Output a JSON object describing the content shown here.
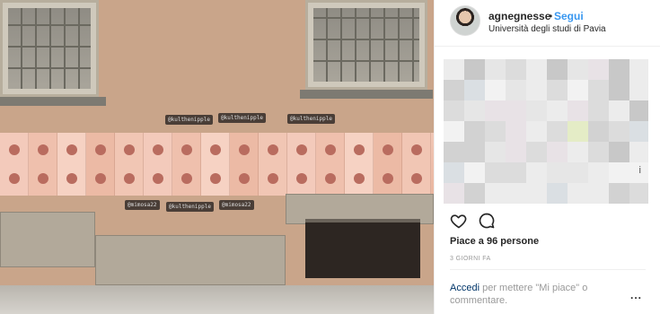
{
  "photo": {
    "stickers_tags": [
      "@kulthenipple",
      "@kulthenipple",
      "@kulthenipple",
      "@mimosa22",
      "@kulthenipple",
      "@mimosa22"
    ],
    "colors": {
      "wall": "#c9a58a",
      "sticker": "#efc1ae",
      "stone": "#b2a99a"
    }
  },
  "post": {
    "username": "agnegnesse",
    "separator": "•",
    "follow_label": "Segui",
    "location": "Università degli studi di Pavia",
    "caption_trailing_char": "i",
    "likes": "Piace a 96 persone",
    "time_ago": "3 GIORNI FA",
    "login_prompt": {
      "link": "Accedi",
      "rest": " per mettere \"Mi piace\" o commentare."
    },
    "more_label": "..."
  },
  "icons": {
    "like": "heart-outline-icon",
    "comment": "comment-bubble-icon"
  },
  "colors": {
    "link": "#3897f0",
    "text": "#262626",
    "muted": "#999999",
    "dark_link": "#003569"
  }
}
